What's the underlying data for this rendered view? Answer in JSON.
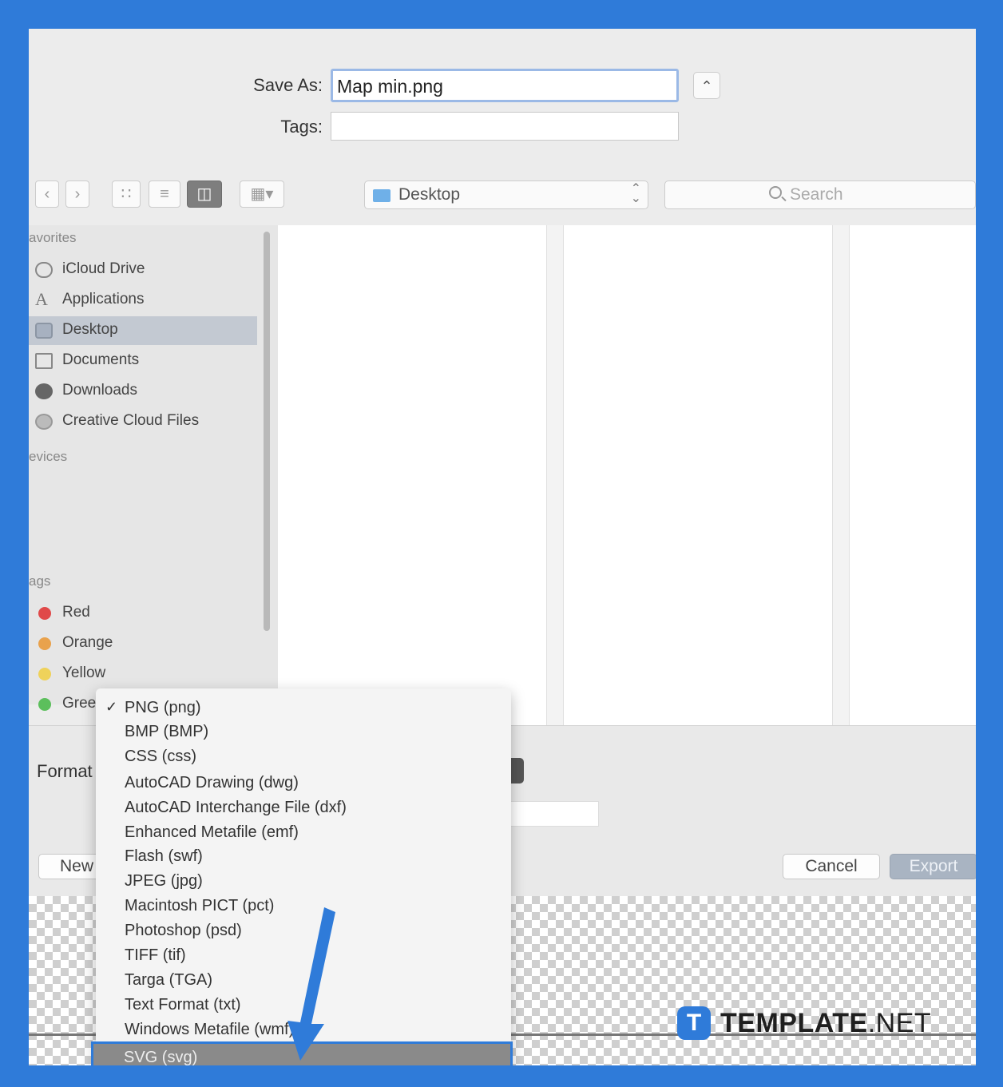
{
  "dialog": {
    "save_as_label": "Save As:",
    "save_as_value": "Map min.png",
    "tags_label": "Tags:",
    "tags_value": "",
    "location": "Desktop",
    "search_placeholder": "Search"
  },
  "sidebar": {
    "favorites_header": "avorites",
    "favorites": [
      {
        "label": "iCloud Drive",
        "icon": "cloud-icon"
      },
      {
        "label": "Applications",
        "icon": "applications-icon"
      },
      {
        "label": "Desktop",
        "icon": "desktop-icon",
        "selected": true
      },
      {
        "label": "Documents",
        "icon": "document-icon"
      },
      {
        "label": "Downloads",
        "icon": "download-icon"
      },
      {
        "label": "Creative Cloud Files",
        "icon": "creative-cloud-icon"
      }
    ],
    "devices_header": "evices",
    "tags_header": "ags",
    "tags": [
      {
        "label": "Red",
        "color": "#e04a4a"
      },
      {
        "label": "Orange",
        "color": "#e9a24c"
      },
      {
        "label": "Yellow",
        "color": "#efd25a"
      },
      {
        "label": "Gree",
        "color": "#5cbf5c"
      }
    ]
  },
  "lower": {
    "format_label": "Format",
    "new_button": "New",
    "cancel_button": "Cancel",
    "export_button": "Export"
  },
  "format_menu": {
    "items": [
      {
        "label": "PNG (png)",
        "checked": true
      },
      {
        "label": "BMP (BMP)"
      },
      {
        "label": "CSS (css)"
      },
      {
        "label": "AutoCAD Drawing (dwg)"
      },
      {
        "label": "AutoCAD Interchange File (dxf)"
      },
      {
        "label": "Enhanced Metafile (emf)"
      },
      {
        "label": "Flash (swf)"
      },
      {
        "label": "JPEG (jpg)"
      },
      {
        "label": "Macintosh PICT (pct)"
      },
      {
        "label": "Photoshop (psd)"
      },
      {
        "label": "TIFF (tif)"
      },
      {
        "label": "Targa (TGA)"
      },
      {
        "label": "Text Format (txt)"
      },
      {
        "label": "Windows Metafile (wmf)"
      },
      {
        "label": "SVG (svg)",
        "highlighted": true
      }
    ]
  },
  "watermark": {
    "logo_letter": "T",
    "brand": "TEMPLATE",
    "suffix": ".NET"
  },
  "colors": {
    "frame": "#2f7bd9",
    "selection": "#c3c9d2",
    "highlight": "#8a8a8a"
  }
}
